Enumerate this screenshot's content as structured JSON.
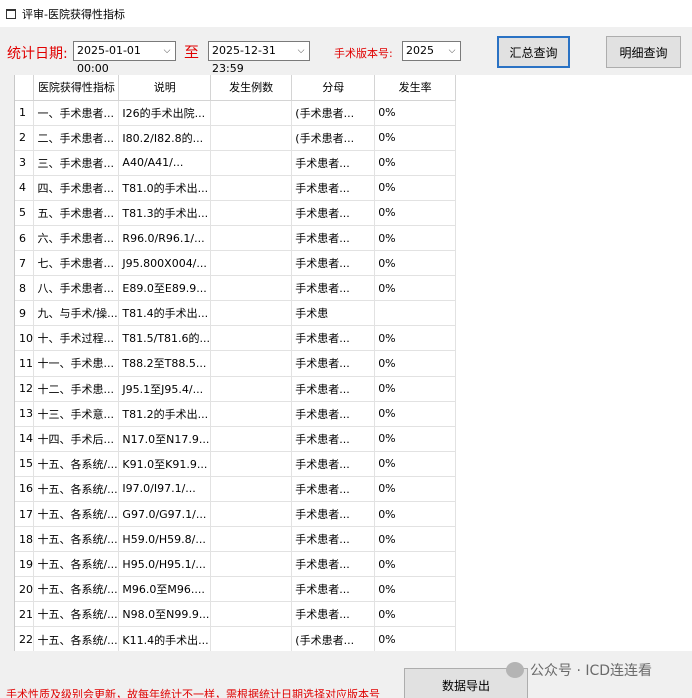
{
  "window": {
    "title": "评审-医院获得性指标"
  },
  "filters": {
    "date_label": "统计日期:",
    "start_date": "2025-01-01 00:00",
    "to_label": "至",
    "end_date": "2025-12-31 23:59",
    "version_label": "手术版本号:",
    "version": "2025"
  },
  "buttons": {
    "summary": "汇总查询",
    "detail": "明细查询",
    "export": "数据导出"
  },
  "grid": {
    "columns": [
      "医院获得性指标",
      "说明",
      "发生例数",
      "分母",
      "发生率"
    ],
    "rows": [
      {
        "num": "1",
        "indicator": "一、手术患者...",
        "desc": "I26的手术出院...",
        "denom": "(手术患者...",
        "rate": "0%"
      },
      {
        "num": "2",
        "indicator": "二、手术患者...",
        "desc": "I80.2/I82.8的...",
        "denom": "(手术患者...",
        "rate": "0%"
      },
      {
        "num": "3",
        "indicator": "三、手术患者...",
        "desc": "A40/A41/...",
        "denom": "手术患者...",
        "rate": "0%"
      },
      {
        "num": "4",
        "indicator": "四、手术患者...",
        "desc": "T81.0的手术出...",
        "denom": "手术患者...",
        "rate": "0%"
      },
      {
        "num": "5",
        "indicator": "五、手术患者...",
        "desc": "T81.3的手术出...",
        "denom": "手术患者...",
        "rate": "0%"
      },
      {
        "num": "6",
        "indicator": "六、手术患者...",
        "desc": "R96.0/R96.1/...",
        "denom": "手术患者...",
        "rate": "0%"
      },
      {
        "num": "7",
        "indicator": "七、手术患者...",
        "desc": "J95.800X004/...",
        "denom": "手术患者...",
        "rate": "0%"
      },
      {
        "num": "8",
        "indicator": "八、手术患者...",
        "desc": "E89.0至E89.9...",
        "denom": "手术患者...",
        "rate": "0%"
      },
      {
        "num": "9",
        "indicator": "九、与手术/操...",
        "desc": "T81.4的手术出...",
        "denom": "手术患",
        "rate": ""
      },
      {
        "num": "10",
        "indicator": "十、手术过程...",
        "desc": "T81.5/T81.6的...",
        "denom": "手术患者...",
        "rate": "0%"
      },
      {
        "num": "11",
        "indicator": "十一、手术患...",
        "desc": "T88.2至T88.5...",
        "denom": "手术患者...",
        "rate": "0%"
      },
      {
        "num": "12",
        "indicator": "十二、手术患...",
        "desc": "J95.1至J95.4/...",
        "denom": "手术患者...",
        "rate": "0%"
      },
      {
        "num": "13",
        "indicator": "十三、手术意...",
        "desc": "T81.2的手术出...",
        "denom": "手术患者...",
        "rate": "0%"
      },
      {
        "num": "14",
        "indicator": "十四、手术后...",
        "desc": "N17.0至N17.9...",
        "denom": "手术患者...",
        "rate": "0%"
      },
      {
        "num": "15",
        "indicator": "十五、各系统/...",
        "desc": "K91.0至K91.9...",
        "denom": "手术患者...",
        "rate": "0%"
      },
      {
        "num": "16",
        "indicator": "十五、各系统/...",
        "desc": "I97.0/I97.1/...",
        "denom": "手术患者...",
        "rate": "0%"
      },
      {
        "num": "17",
        "indicator": "十五、各系统/...",
        "desc": "G97.0/G97.1/...",
        "denom": "手术患者...",
        "rate": "0%"
      },
      {
        "num": "18",
        "indicator": "十五、各系统/...",
        "desc": "H59.0/H59.8/...",
        "denom": "手术患者...",
        "rate": "0%"
      },
      {
        "num": "19",
        "indicator": "十五、各系统/...",
        "desc": "H95.0/H95.1/...",
        "denom": "手术患者...",
        "rate": "0%"
      },
      {
        "num": "20",
        "indicator": "十五、各系统/...",
        "desc": "M96.0至M96....",
        "denom": "手术患者...",
        "rate": "0%"
      },
      {
        "num": "21",
        "indicator": "十五、各系统/...",
        "desc": "N98.0至N99.9...",
        "denom": "手术患者...",
        "rate": "0%"
      },
      {
        "num": "22",
        "indicator": "十五、各系统/...",
        "desc": "K11.4的手术出...",
        "denom": "(手术患者...",
        "rate": "0%"
      }
    ]
  },
  "footer": {
    "note": "手术性质及级别会更新，故每年统计不一样，需根据统计日期选择对应版本号"
  },
  "watermark": {
    "text": "公众号 · ICD连连看"
  }
}
